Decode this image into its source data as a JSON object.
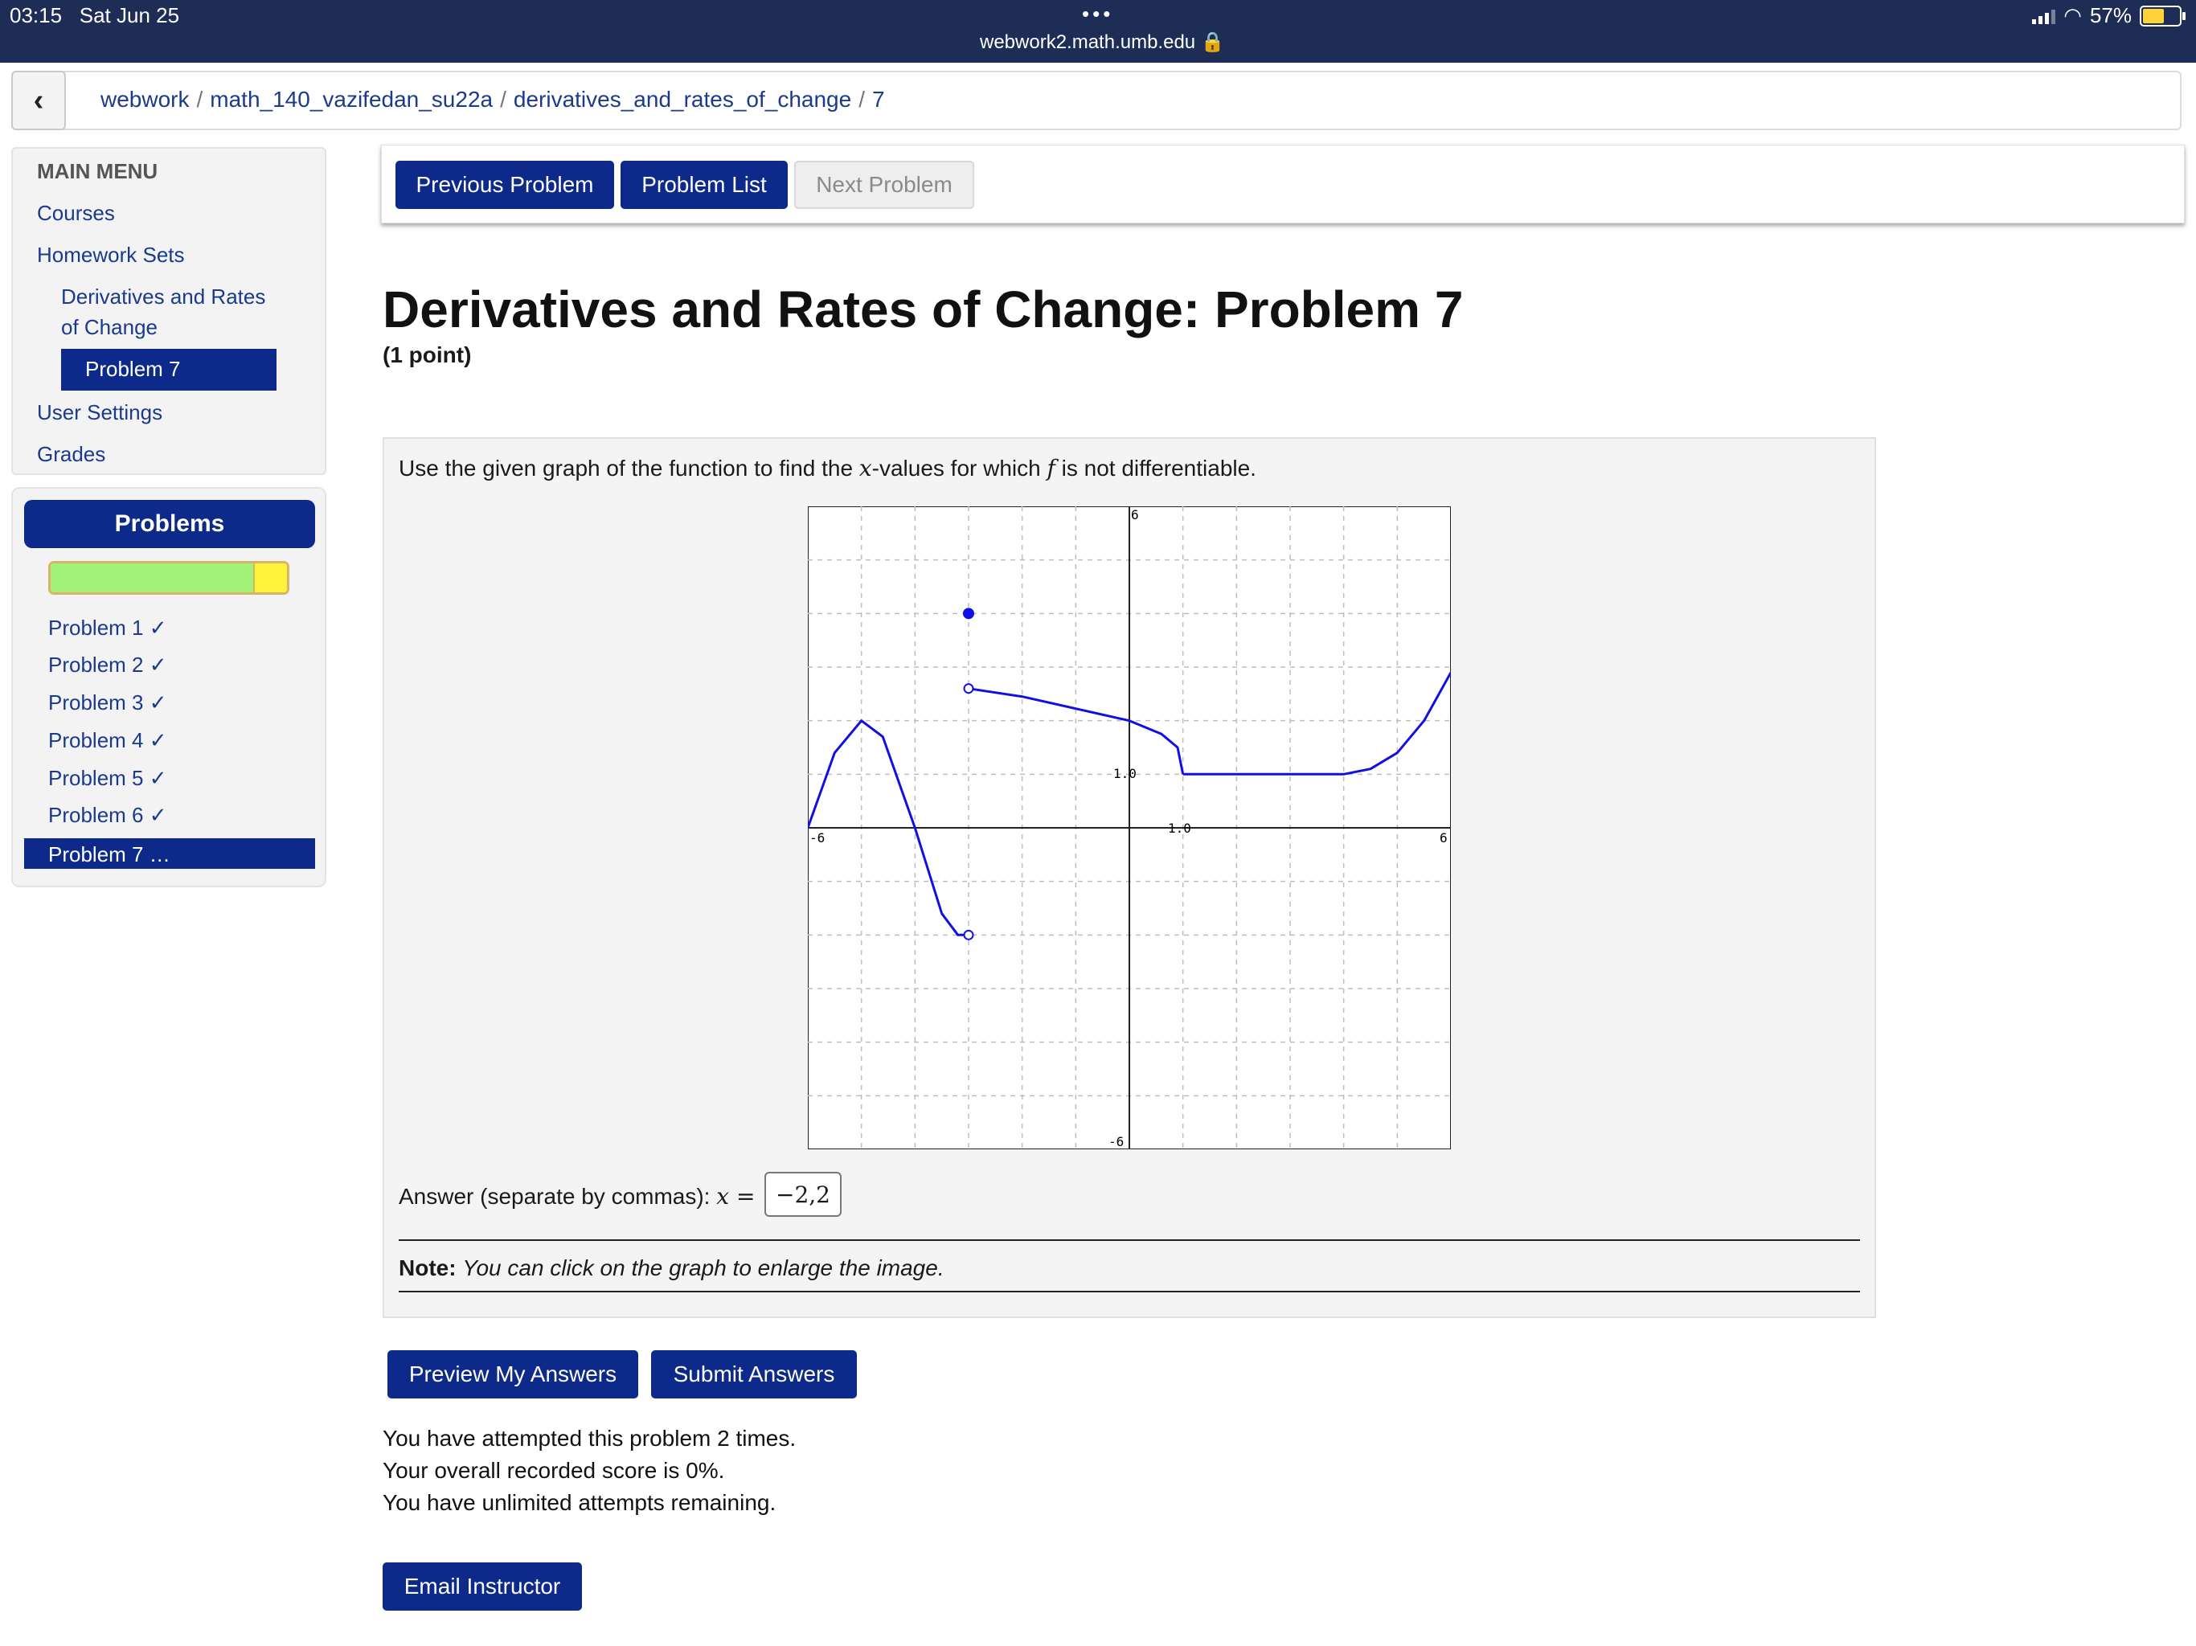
{
  "status": {
    "time": "03:15",
    "date": "Sat Jun 25",
    "url": "webwork2.math.umb.edu",
    "battery": "57%"
  },
  "breadcrumb": [
    "webwork",
    "math_140_vazifedan_su22a",
    "derivatives_and_rates_of_change",
    "7"
  ],
  "menu": {
    "title": "MAIN MENU",
    "courses": "Courses",
    "homework_sets": "Homework Sets",
    "set_line1": "Derivatives and Rates",
    "set_line2": "of Change",
    "problem": "Problem 7",
    "user_settings": "User Settings",
    "grades": "Grades"
  },
  "problems_panel": {
    "title": "Problems",
    "progress_correct_fraction": 0.857,
    "items": [
      "Problem 1 ✓",
      "Problem 2 ✓",
      "Problem 3 ✓",
      "Problem 4 ✓",
      "Problem 5 ✓",
      "Problem 6 ✓"
    ],
    "current": "Problem 7 …"
  },
  "nav": {
    "previous": "Previous Problem",
    "list": "Problem List",
    "next": "Next Problem"
  },
  "heading": {
    "title": "Derivatives and Rates of Change: Problem 7",
    "points": "(1 point)"
  },
  "problem": {
    "prompt_a": "Use the given graph of the function to find the ",
    "var_x": "x",
    "prompt_b": "-values for which ",
    "var_f": "f",
    "prompt_c": " is not differentiable.",
    "answer_label": "Answer (separate by commas): ",
    "answer_eq": "x =",
    "answer_value": "−2,2",
    "note_label": "Note:",
    "note_text": "You can click on the graph to enlarge the image."
  },
  "graph_labels": {
    "ytop": "6",
    "ybottom": "-6",
    "xleft": "-6",
    "xright": "6",
    "ytick": "1.0",
    "xtick": "1.0"
  },
  "chart_data": {
    "type": "line",
    "xlim": [
      -6,
      6
    ],
    "ylim": [
      -6,
      6
    ],
    "grid": true,
    "series": [
      {
        "x": [
          -6,
          -5.5,
          -5,
          -4.6,
          -4,
          -3.5,
          -3.2,
          -3
        ],
        "y": [
          0,
          1.4,
          2,
          1.7,
          0,
          -1.6,
          -2,
          -2
        ]
      },
      {
        "x": [
          -3,
          -2,
          0,
          0.6,
          0.9,
          1
        ],
        "y": [
          2.6,
          2.45,
          2.0,
          1.75,
          1.5,
          1.0
        ]
      },
      {
        "x": [
          1,
          2,
          4,
          4.5,
          5,
          5.5,
          6
        ],
        "y": [
          1,
          1,
          1,
          1.1,
          1.4,
          2.0,
          2.9
        ]
      }
    ],
    "points": [
      {
        "x": -3,
        "y": 4,
        "filled": true
      },
      {
        "x": -3,
        "y": 2.6,
        "filled": false
      },
      {
        "x": -3,
        "y": -2,
        "filled": false
      }
    ]
  },
  "actions": {
    "preview": "Preview My Answers",
    "submit": "Submit Answers",
    "email": "Email Instructor"
  },
  "attempts": {
    "line1": "You have attempted this problem 2 times.",
    "line2": "Your overall recorded score is 0%.",
    "line3": "You have unlimited attempts remaining."
  }
}
